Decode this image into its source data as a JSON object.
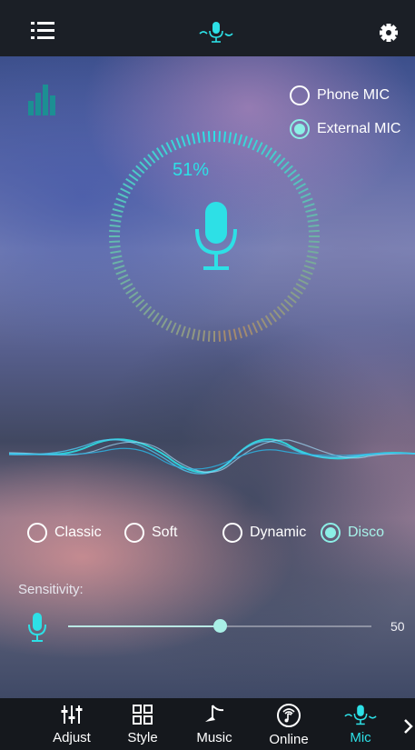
{
  "header": {
    "menu_icon": "menu-icon",
    "logo_icon": "mic-wave-icon",
    "settings_icon": "gear-icon"
  },
  "mic_source": {
    "options": [
      {
        "label": "Phone MIC",
        "selected": false
      },
      {
        "label": "External MIC",
        "selected": true
      }
    ]
  },
  "level_dial": {
    "percent_text": "51%",
    "level_percent": 51,
    "icon": "microphone-icon"
  },
  "modes": [
    {
      "label": "Classic",
      "selected": false
    },
    {
      "label": "Soft",
      "selected": false
    },
    {
      "label": "Dynamic",
      "selected": false
    },
    {
      "label": "Disco",
      "selected": true
    }
  ],
  "sensitivity": {
    "label": "Sensitivity:",
    "value": 50,
    "max": 100,
    "value_text": "50"
  },
  "tabs": [
    {
      "label": "Adjust",
      "icon": "sliders-icon",
      "active": false
    },
    {
      "label": "Style",
      "icon": "grid-icon",
      "active": false
    },
    {
      "label": "Music",
      "icon": "music-note-icon",
      "active": false
    },
    {
      "label": "Online",
      "icon": "radio-icon",
      "active": false
    },
    {
      "label": "Mic",
      "icon": "mic-wave-icon",
      "active": true
    }
  ],
  "colors": {
    "accent": "#2de0e6",
    "active_radio": "#8cefe6",
    "bar_bg": "#1b1f26",
    "gradient_end": "#a38a6f"
  }
}
